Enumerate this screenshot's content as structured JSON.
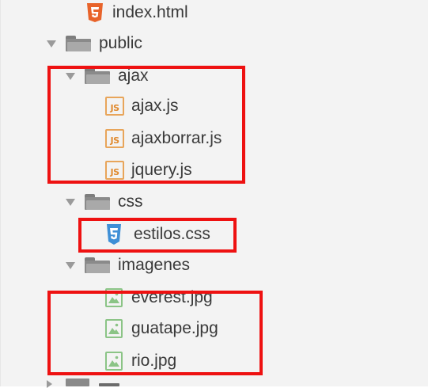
{
  "tree": {
    "items": [
      {
        "label": "index.html",
        "kind": "html-file",
        "depth": 2
      },
      {
        "label": "public",
        "kind": "folder",
        "depth": 1
      },
      {
        "label": "ajax",
        "kind": "folder",
        "depth": 2
      },
      {
        "label": "ajax.js",
        "kind": "js-file",
        "depth": 3
      },
      {
        "label": "ajaxborrar.js",
        "kind": "js-file",
        "depth": 3
      },
      {
        "label": "jquery.js",
        "kind": "js-file",
        "depth": 3
      },
      {
        "label": "css",
        "kind": "folder",
        "depth": 2
      },
      {
        "label": "estilos.css",
        "kind": "css-file",
        "depth": 3
      },
      {
        "label": "imagenes",
        "kind": "folder",
        "depth": 2
      },
      {
        "label": "everest.jpg",
        "kind": "image-file",
        "depth": 3
      },
      {
        "label": "guatape.jpg",
        "kind": "image-file",
        "depth": 3
      },
      {
        "label": "rio.jpg",
        "kind": "image-file",
        "depth": 3
      }
    ],
    "js_icon_text": "JS"
  },
  "icons": {
    "folder": "folder-icon",
    "expand_arrow": "chevron-down-icon",
    "js_file": "javascript-file-icon",
    "html_file": "html5-file-icon",
    "css_file": "css3-file-icon",
    "image_file": "image-file-icon"
  },
  "colors": {
    "panel_bg": "#f3f3f3",
    "text": "#3a3a3a",
    "highlight": "#ee1111",
    "js_icon": "#e08a2e",
    "html_icon": "#e8632a",
    "css_icon": "#3f8fd6",
    "image_icon": "#8bc486"
  }
}
